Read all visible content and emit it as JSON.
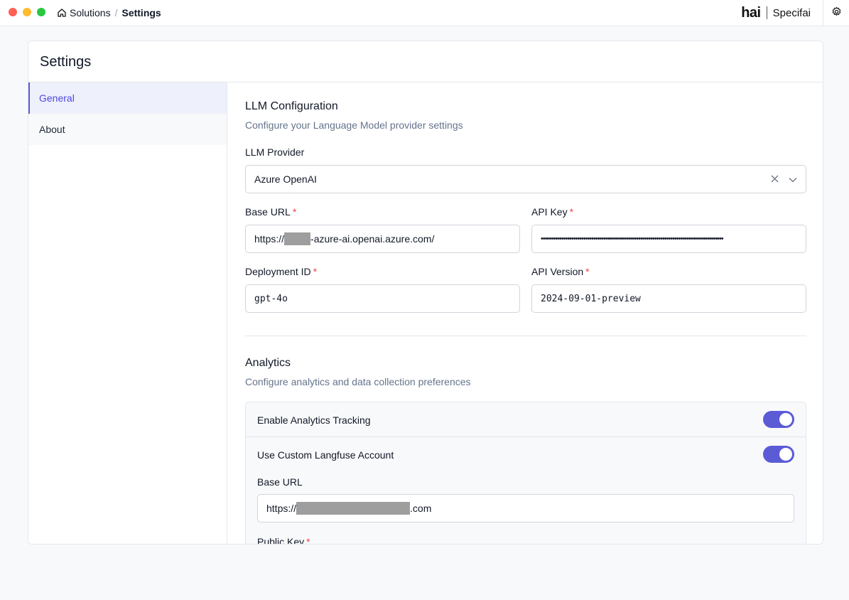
{
  "breadcrumb": {
    "root": "Solutions",
    "separator": "/",
    "current": "Settings"
  },
  "brand": {
    "logo_text": "hai",
    "product": "Specifai"
  },
  "page": {
    "title": "Settings"
  },
  "sidebar": {
    "items": [
      {
        "label": "General",
        "active": true
      },
      {
        "label": "About",
        "active": false
      }
    ]
  },
  "llm": {
    "title": "LLM Configuration",
    "subtitle": "Configure your Language Model provider settings",
    "provider_label": "LLM Provider",
    "provider_value": "Azure OpenAI",
    "base_url_label": "Base URL",
    "base_url_prefix": "https://",
    "base_url_suffix": "-azure-ai.openai.azure.com/",
    "api_key_label": "API Key",
    "api_key_value": "••••••••••••••••••••••••••••••••••••••••••••••••••••••••••••••••••••••••••••••••••••••••••",
    "deployment_label": "Deployment ID",
    "deployment_value": "gpt-4o",
    "api_version_label": "API Version",
    "api_version_value": "2024-09-01-preview",
    "required_mark": "*"
  },
  "analytics": {
    "title": "Analytics",
    "subtitle": "Configure analytics and data collection preferences",
    "tracking_label": "Enable Analytics Tracking",
    "tracking_on": true,
    "langfuse_label": "Use Custom Langfuse Account",
    "langfuse_on": true,
    "base_url_label": "Base URL",
    "base_url_prefix": "https://",
    "base_url_suffix": ".com",
    "public_key_label": "Public Key"
  },
  "colors": {
    "accent": "#5b5bd6",
    "required": "#ef4444"
  }
}
